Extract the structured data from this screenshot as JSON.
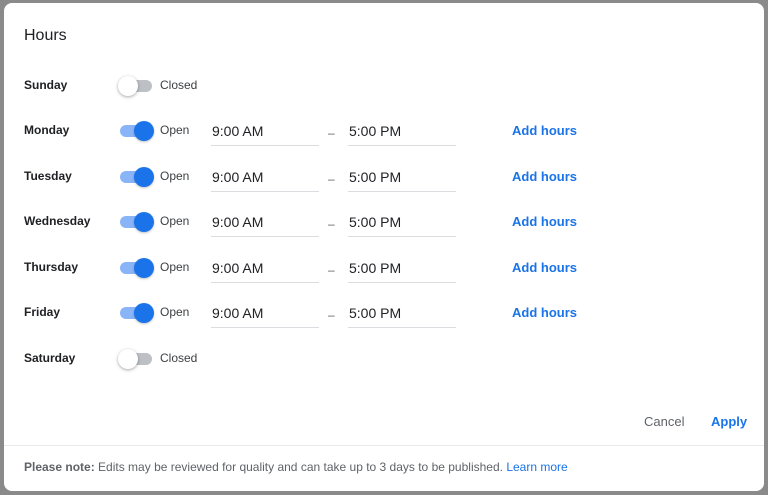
{
  "dialog": {
    "title": "Hours",
    "days": [
      {
        "name": "Sunday",
        "on": false,
        "status": "Closed"
      },
      {
        "name": "Monday",
        "on": true,
        "status": "Open",
        "open_time": "9:00 AM",
        "separator": "–",
        "close_time": "5:00 PM",
        "add_label": "Add hours"
      },
      {
        "name": "Tuesday",
        "on": true,
        "status": "Open",
        "open_time": "9:00 AM",
        "separator": "–",
        "close_time": "5:00 PM",
        "add_label": "Add hours"
      },
      {
        "name": "Wednesday",
        "on": true,
        "status": "Open",
        "open_time": "9:00 AM",
        "separator": "–",
        "close_time": "5:00 PM",
        "add_label": "Add hours"
      },
      {
        "name": "Thursday",
        "on": true,
        "status": "Open",
        "open_time": "9:00 AM",
        "separator": "–",
        "close_time": "5:00 PM",
        "add_label": "Add hours"
      },
      {
        "name": "Friday",
        "on": true,
        "status": "Open",
        "open_time": "9:00 AM",
        "separator": "–",
        "close_time": "5:00 PM",
        "add_label": "Add hours"
      },
      {
        "name": "Saturday",
        "on": false,
        "status": "Closed"
      }
    ],
    "buttons": {
      "cancel": "Cancel",
      "apply": "Apply"
    },
    "footer": {
      "note_label": "Please note:",
      "note_text": "Edits may be reviewed for quality and can take up to 3 days to be published.",
      "learn_more": "Learn more"
    }
  },
  "colors": {
    "accent": "#1a73e8",
    "toggle_on_track": "#8ab4f8",
    "toggle_off_track": "#bdc1c6"
  }
}
